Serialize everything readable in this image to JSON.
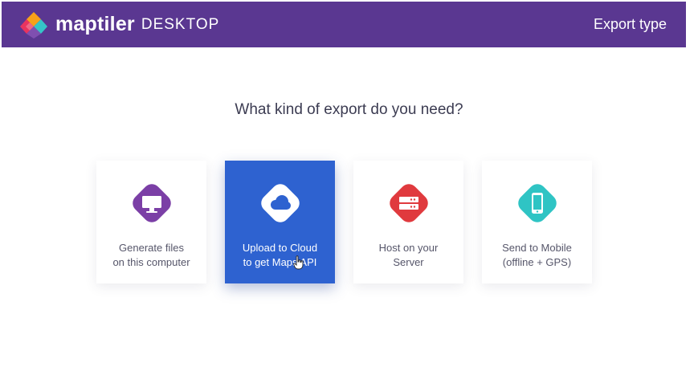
{
  "app": {
    "brand_name": "maptiler",
    "brand_sub": "DESKTOP",
    "page_title": "Export type"
  },
  "main": {
    "question": "What kind of export do you need?"
  },
  "cards": [
    {
      "id": "generate-files",
      "line1": "Generate files",
      "line2": "on this computer",
      "icon": "monitor-icon",
      "color": "#7b3fa6",
      "selected": false
    },
    {
      "id": "upload-cloud",
      "line1": "Upload to Cloud",
      "line2": "to get Maps API",
      "icon": "cloud-icon",
      "color": "#2e62d0",
      "selected": true
    },
    {
      "id": "host-server",
      "line1": "Host on your",
      "line2": "Server",
      "icon": "server-icon",
      "color": "#e03a3e",
      "selected": false
    },
    {
      "id": "send-mobile",
      "line1": "Send to Mobile",
      "line2": "(offline + GPS)",
      "icon": "mobile-phone-icon",
      "color": "#2fc4c4",
      "selected": false
    }
  ],
  "colors": {
    "header_bg": "#5a3791",
    "selected_card_bg": "#2e62d0",
    "text": "#3c3c52"
  }
}
